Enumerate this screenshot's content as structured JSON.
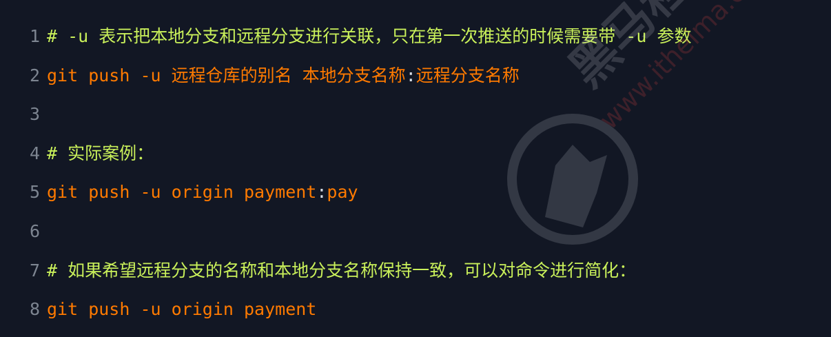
{
  "lines": [
    {
      "number": "1",
      "tokens": [
        {
          "text": "# -u 表示把本地分支和远程分支进行关联，只在第一次推送的时候需要带 -u 参数",
          "class": "c-comment"
        }
      ]
    },
    {
      "number": "2",
      "tokens": [
        {
          "text": "git push ",
          "class": "c-cmd"
        },
        {
          "text": "-u",
          "class": "c-flag"
        },
        {
          "text": " 远程仓库的别名 本地分支名称",
          "class": "c-cn"
        },
        {
          "text": ":",
          "class": "c-plain"
        },
        {
          "text": "远程分支名称",
          "class": "c-cn"
        }
      ]
    },
    {
      "number": "3",
      "tokens": []
    },
    {
      "number": "4",
      "tokens": [
        {
          "text": "# 实际案例：",
          "class": "c-comment"
        }
      ]
    },
    {
      "number": "5",
      "tokens": [
        {
          "text": "git push ",
          "class": "c-cmd"
        },
        {
          "text": "-u",
          "class": "c-flag"
        },
        {
          "text": " origin payment",
          "class": "c-cmd"
        },
        {
          "text": ":",
          "class": "c-plain"
        },
        {
          "text": "pay",
          "class": "c-cmd"
        }
      ]
    },
    {
      "number": "6",
      "tokens": []
    },
    {
      "number": "7",
      "tokens": [
        {
          "text": "# 如果希望远程分支的名称和本地分支名称保持一致，可以对命令进行简化：",
          "class": "c-comment"
        }
      ]
    },
    {
      "number": "8",
      "tokens": [
        {
          "text": "git push ",
          "class": "c-cmd"
        },
        {
          "text": "-u",
          "class": "c-flag"
        },
        {
          "text": " origin payment",
          "class": "c-cmd"
        }
      ]
    }
  ],
  "colors": {
    "background": "#121724",
    "line_number": "#7d8591",
    "comment": "#c9f05a",
    "command": "#ff7a00",
    "plain": "#d7dde6"
  },
  "watermark": {
    "text_1": "黑马程",
    "text_2": "www.itheima.com",
    "icon": "horse-logo-icon"
  }
}
